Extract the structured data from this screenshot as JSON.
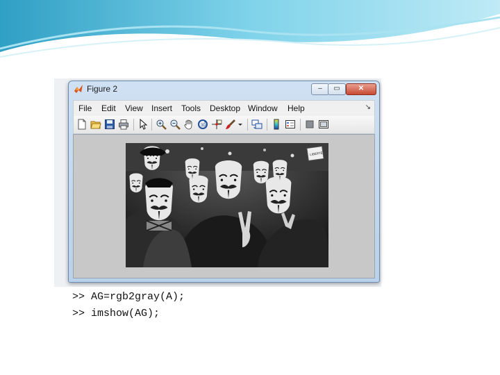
{
  "figure_window": {
    "title": "Figure 2",
    "controls": {
      "minimize": "–",
      "maximize": "▭",
      "close": "✕"
    }
  },
  "menubar": {
    "items": [
      "File",
      "Edit",
      "View",
      "Insert",
      "Tools",
      "Desktop",
      "Window",
      "Help"
    ],
    "overflow_arrow": "↘"
  },
  "toolbar": {
    "buttons": [
      "new-figure-icon",
      "open-file-icon",
      "save-icon",
      "print-icon",
      "edit-plot-arrow-icon",
      "zoom-in-icon",
      "zoom-out-icon",
      "pan-hand-icon",
      "rotate-3d-icon",
      "data-cursor-icon",
      "brush-icon",
      "brush-dropdown-icon",
      "link-plot-icon",
      "insert-colorbar-icon",
      "insert-legend-icon",
      "hide-plot-tools-icon",
      "show-plot-tools-icon"
    ]
  },
  "image_panel": {
    "description_label": "grayscale image",
    "photo_sign_text": "LIBERTÉ"
  },
  "command_window": {
    "lines": [
      ">> AG=rgb2gray(A);",
      ">> imshow(AG);"
    ]
  },
  "colors": {
    "title_bar": "#c5daf0",
    "close_button": "#c74a33",
    "canvas_bg": "#c8c8c8",
    "wave_primary": "#5fc3de"
  }
}
